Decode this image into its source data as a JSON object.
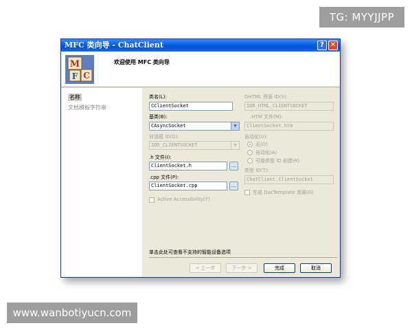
{
  "watermark_top": "TG: MYYJJPP",
  "watermark_bottom": "www.wanbotiyucn.com",
  "window": {
    "title": "MFC 类向导 - ChatClient",
    "help_label": "?",
    "close_label": "✕"
  },
  "header": {
    "title": "欢迎使用 MFC 类向导",
    "logo_letters": [
      "M",
      "F",
      "C"
    ]
  },
  "nav": {
    "items": [
      "名称",
      "文档模板字符串"
    ]
  },
  "form": {
    "class_name_label": "类名(L):",
    "class_name_value": "CClientSocket",
    "base_class_label": "基类(B):",
    "base_class_value": "CAsyncSocket",
    "dialog_id_label": "对话框 ID(D):",
    "dialog_id_value": "IDD_CLIENTSOCKET",
    "h_file_label": ".h 文件(I):",
    "h_file_value": "ClientSocket.h",
    "cpp_file_label": ".cpp 文件(P):",
    "cpp_file_value": "ClientSocket.cpp",
    "browse_label": "...",
    "active_accessibility_label": "Active Accessibility(Y)",
    "dhtml_id_label": "DHTML 资源 ID(S):",
    "dhtml_id_value": "IDR_HTML_CLIENTSOCKET",
    "htm_file_label": ".HTM 文件(M):",
    "htm_file_value": "ClientSocket.htm",
    "automation_label": "自动化(U):",
    "radio_none": "无(O)",
    "radio_automation": "自动化(A)",
    "radio_creatable": "可按类型 ID 创建(R)",
    "type_id_label": "类型 ID(T):",
    "type_id_value": "ChatClient.ClientSocket",
    "doctemplate_label": "生成 DocTemplate 资源(G)"
  },
  "bottom_note": "单击此处可查看不支持的智能设备选项",
  "buttons": {
    "back": "< 上一步",
    "next": "下一步 >",
    "finish": "完成",
    "cancel": "取消"
  }
}
